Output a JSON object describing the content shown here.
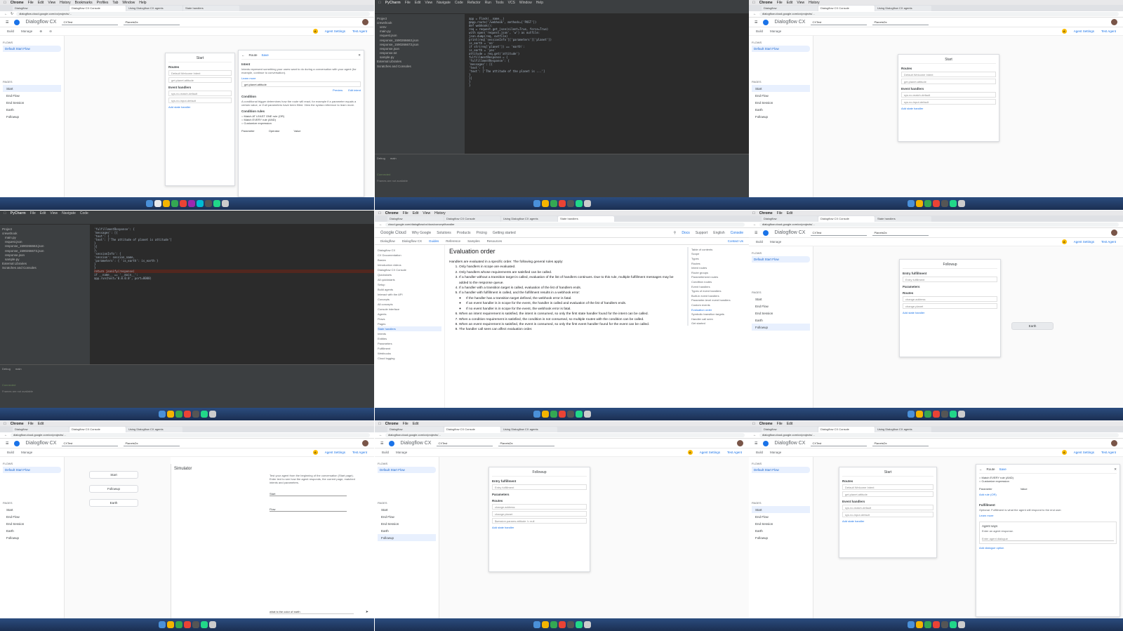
{
  "os_menu": {
    "chrome": [
      "Chrome",
      "File",
      "Edit",
      "View",
      "History",
      "Bookmarks",
      "Profiles",
      "Tab",
      "Window",
      "Help"
    ],
    "pycharm": [
      "PyCharm",
      "File",
      "Edit",
      "View",
      "Navigate",
      "Code",
      "Refactor",
      "Run",
      "Tools",
      "VCS",
      "Window",
      "Help"
    ]
  },
  "browser_tabs": [
    "Dialogflow",
    "Dialogflow CX Console",
    "Using Dialogflow CX agents",
    "State handlers",
    "Dialogflow CX"
  ],
  "url": "dialogflow.cloud.google.com/cx/projects/...",
  "docs_url": "cloud.google.com/dialogflow/cx/docs/concept/handler",
  "app": {
    "title": "Dialogflow CX",
    "project_label": "Project",
    "project": "CXTest",
    "agent_label": "Agent",
    "agent": "PlanetsDx",
    "lang": "en",
    "tabs": [
      "Build",
      "Manage"
    ],
    "agent_settings": "Agent Settings",
    "test_agent": "Test Agent"
  },
  "sidebar": {
    "flows_header": "FLOWS",
    "flow": "Default Start Flow",
    "pages_header": "PAGES",
    "pages": [
      "Start",
      "End Flow",
      "End Session",
      "Earth",
      "Followup"
    ]
  },
  "route_panel": {
    "title": "Route",
    "save": "Save",
    "intent_header": "Intent",
    "intent_desc": "Intents represent something your users want to do during a conversation with your agent (for example, continue to conversation).",
    "learn_more": "Learn more",
    "intent_value": "get.planet.attitude",
    "preview": "Preview",
    "edit_intent": "Edit intent",
    "condition_header": "Condition",
    "condition_desc": "A conditional trigger determines how the route will react, for example if a parameter equals a certain value, or if all parameters have been filled. View the syntax reference to learn more.",
    "condition_rules": "Condition rules",
    "options": [
      "Match AT LEAST ONE rule (OR)",
      "Match EVERY rule (AND)",
      "Customize expression"
    ],
    "parameter": "Parameter",
    "operator": "Operator",
    "value": "Value"
  },
  "start_panel": {
    "title": "Start",
    "routes": "Routes",
    "route_items": [
      "Default Welcome Intent",
      "get.planet.attitude"
    ],
    "event_handlers": "Event handlers",
    "event_items": [
      "sys.no-match-default",
      "sys.no-input-default"
    ],
    "add_state_handler": "Add state handler"
  },
  "followup_panel": {
    "title": "Followup",
    "entry_fulfillment": "Entry fulfillment",
    "entry_value": "Entry fulfillment",
    "parameters": "Parameters",
    "routes": "Routes",
    "route_items": [
      "change.address",
      "change.planet",
      "$session.params.attitude != null"
    ],
    "add_state_handler": "Add state handler"
  },
  "graph_nodes": [
    "Start",
    "Followup",
    "Earth"
  ],
  "simulator": {
    "title": "Simulator",
    "desc": "Test your agent from the beginning of the conversation (Start page). Enter text to see how the agent responds, the current page, matched intents and parameters.",
    "start_label": "Start",
    "page_value": "Start",
    "flow_value": "Flow",
    "input_placeholder": "what is the color of earth"
  },
  "fulfillment_panel": {
    "route": "Route",
    "save": "Save",
    "match_every": "Match EVERY rule (AND)",
    "customize": "Customize expression",
    "parameter": "Parameter",
    "value": "Value",
    "add_rule": "Add rule (OR)",
    "fulfillment_header": "Fulfillment",
    "fulfillment_desc": "Optional. Fulfillment is what the agent will respond to the end user.",
    "learn_more": "Learn more",
    "agent_says": "Agent says",
    "agent_says_hint": "Enter an agent response.",
    "enter_agent_dialogue": "Enter agent dialogue",
    "add_dialogue_option": "Add dialogue option"
  },
  "ide": {
    "project_title": "Project",
    "files": [
      "crewshook",
      "venv",
      "main.py",
      "request.json",
      "response_1590266663.json",
      "response_1590266673.json",
      "response.json",
      "response.txt",
      "sample.py",
      "External Libraries",
      "Scratches and Consoles"
    ],
    "code_a": [
      "app = Flask(__name__)",
      "@app.route('/webhook', methods=['POST'])",
      "def webhook():",
      "    req = request.get_json(silent=True, force=True)",
      "    with open('request.json', 'w') as outfile:",
      "        json.dump(req, outfile)",
      "    print(req['sessionInfo']['parameters']['planet'])",
      "    is_earth = 'no'",
      "    if str(req['planet']) == 'earth':",
      "        is_earth = 'yes'",
      "    attitude = req.get('attitude')",
      "    fulfillmentResponse = {",
      "        'fulfillmentResponse': {",
      "            'messages': [{",
      "                'text': {",
      "                    'text': ['The attitude of the planet is ...']",
      "                }",
      "            }]",
      "        }",
      "    }"
    ],
    "code_b": [
      "        'fulfillmentResponse': {",
      "            'messages': [{",
      "                'text': {",
      "                    'text': ['The attitude of planet is attitude']",
      "                }",
      "            }]",
      "        },",
      "        'sessionInfo': {",
      "            'session': session_name,",
      "            'parameters': { 'is_earth': is_earth }",
      "        }",
      "    }",
      "    return jsonify(response)",
      "",
      "if __name__ == '__main__':",
      "    app.run(host='0.0.0.0', port=8000)"
    ],
    "debug_label": "Debug",
    "debug_tab": "main",
    "console": "Connected",
    "frames": "Frames are not available"
  },
  "docs": {
    "brand": "Google Cloud",
    "nav": [
      "Why Google",
      "Solutions",
      "Products",
      "Pricing",
      "Getting started"
    ],
    "sub_nav": [
      "Dialogflow",
      "Dialogflow CX",
      "Guides",
      "Reference",
      "Samples",
      "Resources"
    ],
    "docs_tab": "Docs",
    "support": "Support",
    "language": "English",
    "console": "Console",
    "contact": "Contact Us",
    "left_nav": [
      "Dialogflow CX",
      "CX Documentation",
      "Basics",
      "Introduction videos",
      "Dialogflow CX Console",
      "Quickstarts",
      "All quickstarts",
      "Setup",
      "Build agents",
      "Interact with the API",
      "Concepts",
      "All concepts",
      "Console interface",
      "Agents",
      "Flows",
      "Pages",
      "State handlers",
      "Intents",
      "Entities",
      "Parameters",
      "Fulfillment",
      "Webhooks",
      "Cloud logging"
    ],
    "current": "State handlers",
    "heading": "Evaluation order",
    "intro": "Handlers are evaluated in a specific order. The following general rules apply:",
    "rules": [
      "Only handlers in scope are evaluated.",
      "Only handlers whose requirements are satisfied can be called.",
      "If a handler without a transition target is called, evaluation of the list of handlers continues. Due to this rule, multiple fulfillment messages may be added to the response queue.",
      "If a handler with a transition target is called, evaluation of the list of handlers ends.",
      "If a handler with fulfillment is called, and the fulfillment results in a webhook error:",
      "When an intent requirement is satisfied, the intent is consumed, so only the first state handler found for the intent can be called.",
      "When a condition requirement is satisfied, the condition is not consumed, so multiple routes with the condition can be called.",
      "When an event requirement is satisfied, the event is consumed, so only the first event handler found for the event can be called.",
      "The handler call sees can affect evaluation order."
    ],
    "subrules": [
      "If the handler has a transition target defined, the webhook error is fatal.",
      "If an event handler is in scope for the event, the handler is called and evaluation of the list of handlers ends.",
      "If no event handler is in scope for the event, the webhook error is fatal."
    ],
    "toc": [
      "Table of contents",
      "Scope",
      "Types",
      "Routes",
      "Intent routes",
      "Route groups",
      "Parameterized routes",
      "Condition routes",
      "Event handlers",
      "Types of event handlers",
      "Built-in event handlers",
      "Parameter-level event handlers",
      "Custom events",
      "Evaluation order",
      "Symbolic transition targets",
      "Handler call seen",
      "Get started"
    ]
  },
  "colors": {
    "accent": "#1a73e8",
    "ide_bg": "#2b2b2b",
    "ide_panel": "#3c3f41",
    "dock": "#1b2f52"
  }
}
